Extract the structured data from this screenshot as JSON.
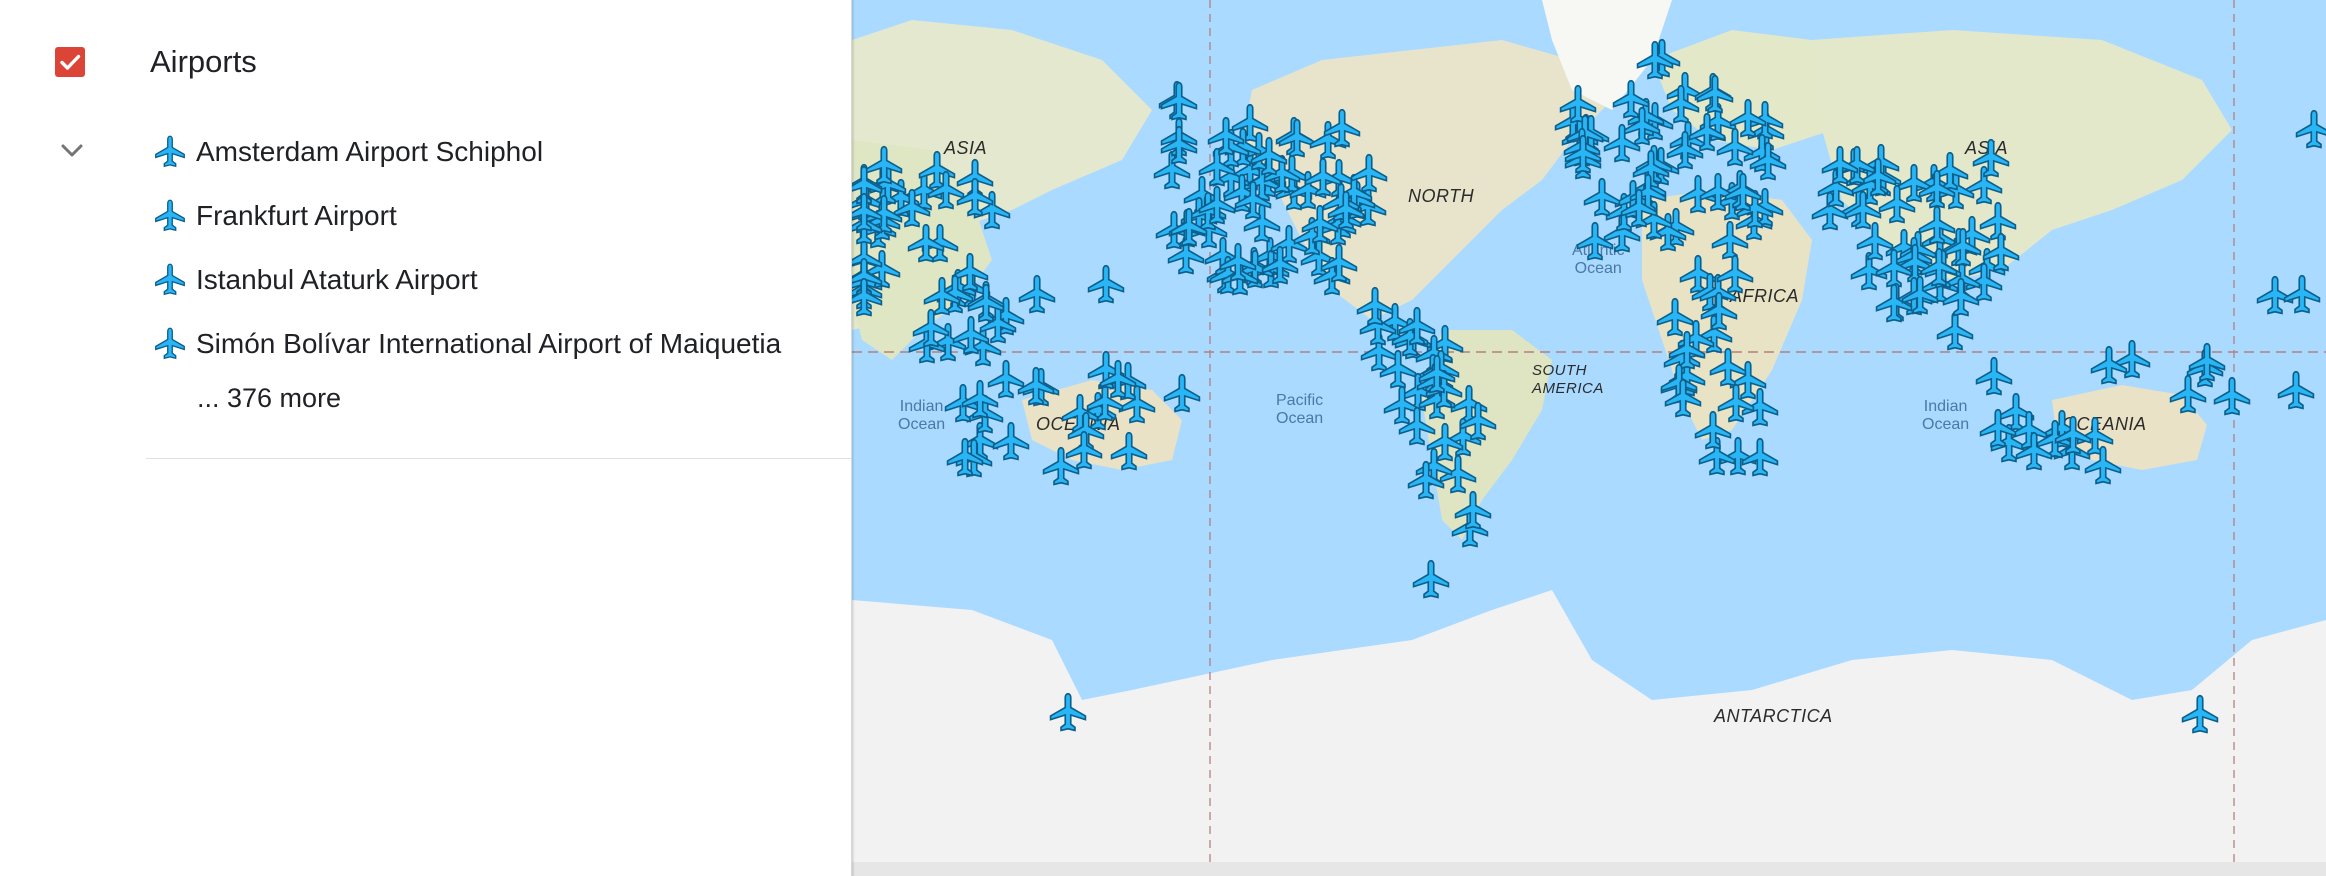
{
  "layer": {
    "title": "Airports",
    "checked": true,
    "checkbox_color": "#db4437",
    "icon": "check-icon",
    "expand_icon": "chevron-down-icon"
  },
  "items": [
    {
      "label": "Amsterdam Airport Schiphol",
      "icon": "airplane-icon"
    },
    {
      "label": "Frankfurt Airport",
      "icon": "airplane-icon"
    },
    {
      "label": "Istanbul Ataturk Airport",
      "icon": "airplane-icon"
    },
    {
      "label": "Simón Bolívar International Airport of Maiquetia",
      "icon": "airplane-icon"
    }
  ],
  "more_label": "... 376 more",
  "map": {
    "marker_color": "#29b6f6",
    "marker_outline": "#0d5f8a",
    "water_color": "#aadaff",
    "land_color": "#eae5d9",
    "ice_color": "#f2f2f2",
    "continent_labels": [
      "ASIA",
      "NORTH",
      "AFRICA",
      "SOUTH AMERICA",
      "OCEANIA",
      "ASIA",
      "OCEANIA",
      "ANTARCTICA"
    ],
    "ocean_labels": [
      "Atlantic\nOcean",
      "Indian\nOcean",
      "Pacific\nOcean",
      "Indian\nOcean"
    ]
  }
}
